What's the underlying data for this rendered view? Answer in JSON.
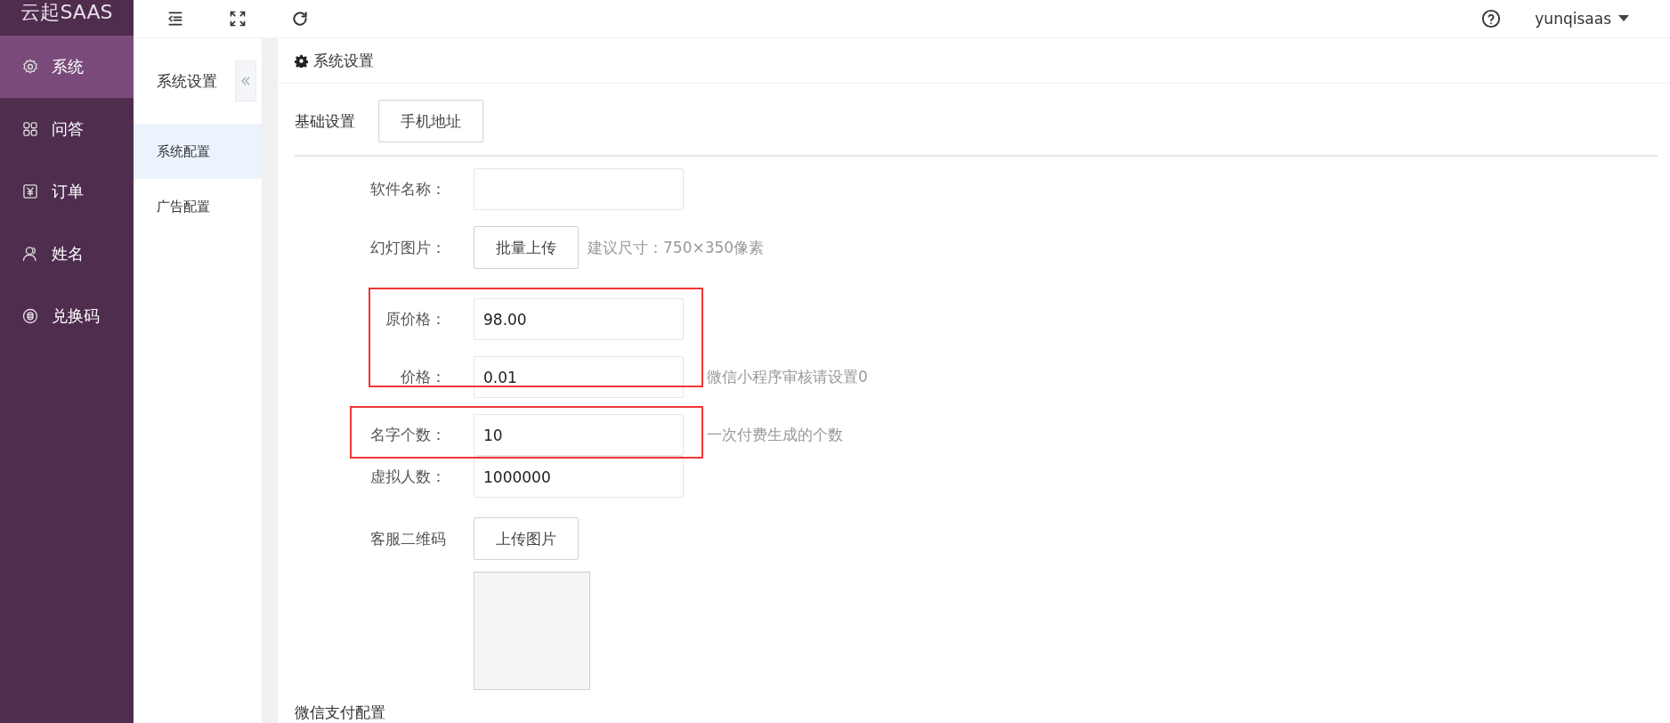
{
  "sidebar": {
    "logo": "云起SAAS",
    "items": [
      {
        "label": "系统",
        "selected": true
      },
      {
        "label": "问答",
        "selected": false
      },
      {
        "label": "订单",
        "selected": false
      },
      {
        "label": "姓名",
        "selected": false
      },
      {
        "label": "兑换码",
        "selected": false
      }
    ]
  },
  "header": {
    "user": "yunqisaas"
  },
  "subnav": {
    "title": "系统设置",
    "items": [
      {
        "label": "系统配置",
        "selected": true
      },
      {
        "label": "广告配置",
        "selected": false
      }
    ]
  },
  "panel": {
    "title": "系统设置",
    "section": "基础设置",
    "tab_button": "手机地址",
    "fields": [
      {
        "kind": "input",
        "label": "软件名称："
      },
      {
        "kind": "upload",
        "label": "幻灯图片：",
        "button": "批量上传",
        "hint": "建议尺寸：750×350像素"
      },
      {
        "kind": "input",
        "label": "原价格：",
        "value": "98.00"
      },
      {
        "kind": "input",
        "label": "价格：",
        "value": "0.01",
        "hint": "微信小程序审核请设置0"
      },
      {
        "kind": "input",
        "label": "名字个数：",
        "value": "10",
        "hint": "一次付费生成的个数"
      },
      {
        "kind": "input",
        "label": "虚拟人数：",
        "value": "1000000"
      },
      {
        "kind": "upload",
        "label": "客服二维码",
        "button": "上传图片"
      },
      {
        "kind": "image"
      }
    ],
    "next_section": "微信支付配置"
  }
}
